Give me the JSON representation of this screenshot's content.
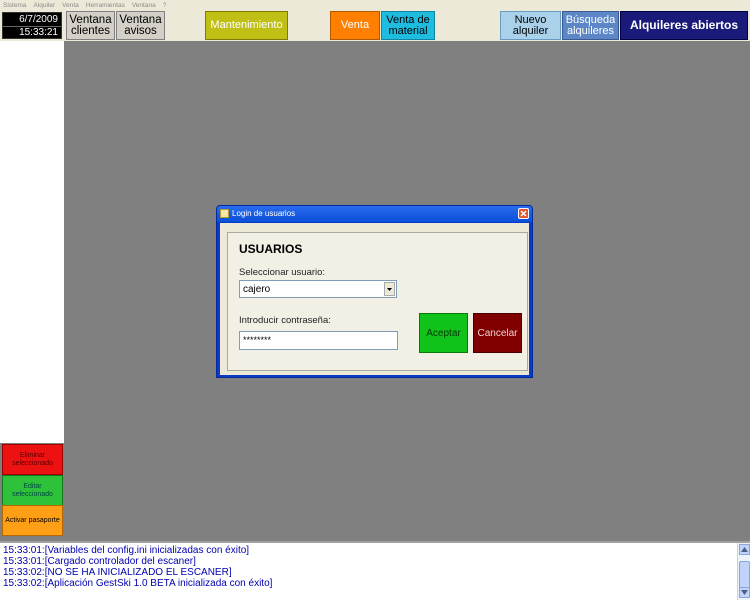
{
  "menu": [
    "Sistema",
    "Alquiler",
    "Venta",
    "Herramientas",
    "Ventana",
    "?"
  ],
  "datetime": {
    "date": "6/7/2009",
    "time": "15:33:21"
  },
  "toolbar": {
    "ventana_clientes": "Ventana clientes",
    "ventana_avisos": "Ventana avisos",
    "mantenimiento": "Mantenimiento",
    "venta": "Venta",
    "venta_material": "Venta de material",
    "nuevo_alquiler": "Nuevo alquiler",
    "busqueda_alquileres": "Búsqueda alquileres",
    "alquileres_abiertos": "Alquileres abiertos"
  },
  "left_buttons": {
    "eliminar": "Eliminar seleccionado",
    "editar": "Editar seleccionado",
    "activar": "Activar pasaporte"
  },
  "log": [
    "15:33:01:[Variables del config.ini inicializadas con éxito]",
    "15:33:01:[Cargado controlador del escaner]",
    "15:33:02:[NO SE HA INICIALIZADO EL ESCANER]",
    "15:33:02:[Aplicación GestSki 1.0 BETA inicializada con éxito]"
  ],
  "dialog": {
    "title": "Login de usuarios",
    "heading": "USUARIOS",
    "select_label": "Seleccionar usuario:",
    "select_value": "cajero",
    "password_label": "Introducir contraseña:",
    "password_value": "********",
    "accept": "Aceptar",
    "cancel": "Cancelar"
  },
  "colors": {
    "mantenimiento": "#bfbf16",
    "venta": "#ff8000",
    "venta_material": "#1ebde0",
    "accept": "#11c21b",
    "cancel": "#800000",
    "alquileres_abiertos": "#1a1a7a"
  },
  "icons": {
    "dialog_icon": "window-icon",
    "close": "close-icon",
    "dropdown": "chevron-down-icon",
    "scroll_up": "chevron-up-icon",
    "scroll_down": "chevron-down-icon"
  }
}
